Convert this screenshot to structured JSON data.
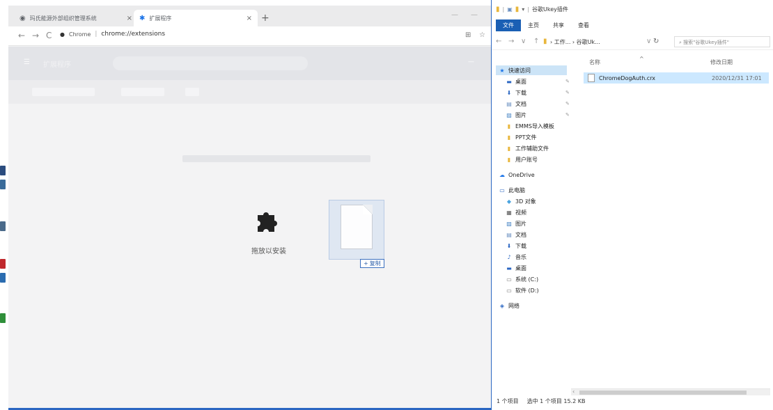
{
  "chrome": {
    "tabs": [
      {
        "label": "玛氏能源外部组织管理系统",
        "icon": "globe-icon"
      },
      {
        "label": "扩展程序",
        "icon": "puzzle-icon"
      }
    ],
    "new_tab": "+",
    "url_secure": "Chrome",
    "url_sep": "|",
    "url": "chrome://extensions",
    "header_title": "扩展程序",
    "drop_label": "拖放以安装",
    "copy_badge": "复制"
  },
  "explorer": {
    "title": "谷歌Ukey插件",
    "ribbon": [
      "文件",
      "主页",
      "共享",
      "查看"
    ],
    "breadcrumb": "› 工作... › 谷歌Uk...",
    "search_placeholder": "搜索\"谷歌Ukey插件\"",
    "col_name": "名称",
    "col_date": "修改日期",
    "sidebar": [
      {
        "label": "快速访问",
        "icon": "star-icon",
        "pin": false
      },
      {
        "label": "桌面",
        "icon": "desktop-icon",
        "pin": true
      },
      {
        "label": "下载",
        "icon": "download-icon",
        "pin": true
      },
      {
        "label": "文档",
        "icon": "document-icon",
        "pin": true
      },
      {
        "label": "图片",
        "icon": "picture-icon",
        "pin": true
      },
      {
        "label": "EMMS导入模板",
        "icon": "folder-icon",
        "pin": false
      },
      {
        "label": "PPT文件",
        "icon": "folder-icon",
        "pin": false
      },
      {
        "label": "工作辅助文件",
        "icon": "folder-icon",
        "pin": false
      },
      {
        "label": "用户账号",
        "icon": "folder-icon",
        "pin": false
      },
      {
        "label": "OneDrive",
        "icon": "cloud-icon",
        "pin": false
      },
      {
        "label": "此电脑",
        "icon": "computer-icon",
        "pin": false
      },
      {
        "label": "3D 对象",
        "icon": "cube-icon",
        "pin": false
      },
      {
        "label": "视频",
        "icon": "video-icon",
        "pin": false
      },
      {
        "label": "图片",
        "icon": "picture-icon",
        "pin": false
      },
      {
        "label": "文档",
        "icon": "document-icon",
        "pin": false
      },
      {
        "label": "下载",
        "icon": "download-icon",
        "pin": false
      },
      {
        "label": "音乐",
        "icon": "music-icon",
        "pin": false
      },
      {
        "label": "桌面",
        "icon": "desktop-icon",
        "pin": false
      },
      {
        "label": "系统 (C:)",
        "icon": "drive-icon",
        "pin": false
      },
      {
        "label": "软件 (D:)",
        "icon": "drive-icon",
        "pin": false
      },
      {
        "label": "网络",
        "icon": "network-icon",
        "pin": false
      }
    ],
    "file": {
      "name": "ChromeDogAuth.crx",
      "date": "2020/12/31 17:01"
    },
    "status": [
      "1 个项目",
      "选中 1 个项目  15.2 KB"
    ]
  },
  "colors": {
    "accent": "#2a66c2",
    "selection": "#cce8ff"
  }
}
